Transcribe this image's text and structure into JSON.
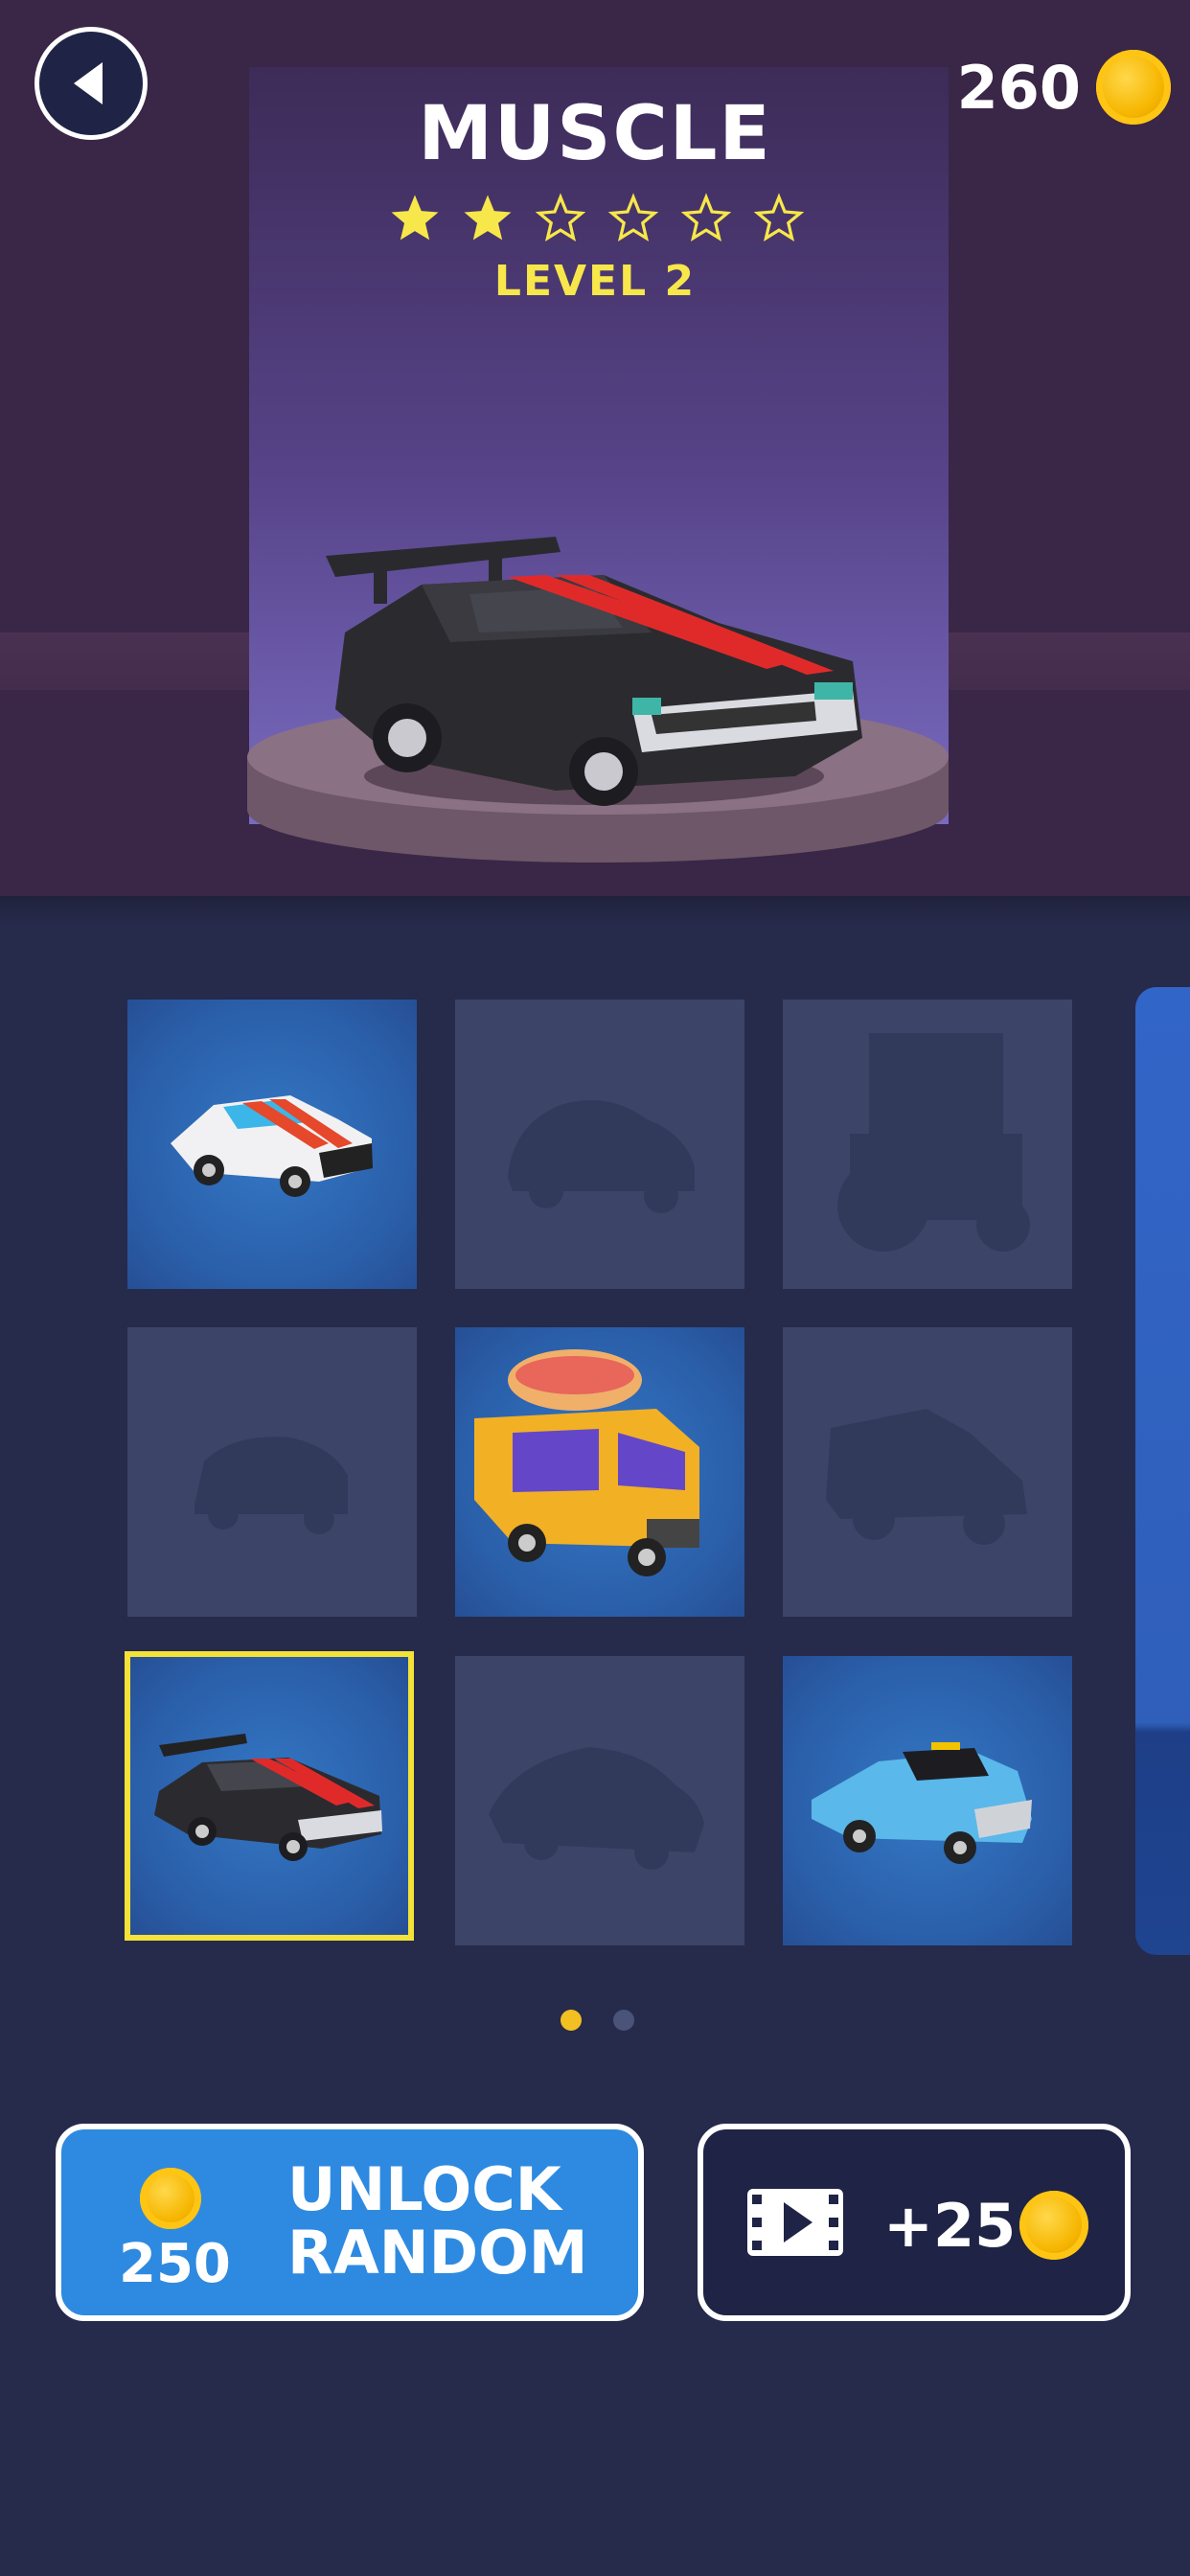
{
  "header": {
    "coin_count": "260",
    "car_name": "MUSCLE",
    "level_label": "LEVEL 2",
    "stars_filled": 2,
    "stars_total": 6
  },
  "grid": {
    "tiles": [
      {
        "state": "owned",
        "vehicle": "white-red-sports-car"
      },
      {
        "state": "locked",
        "vehicle": "beetle-silhouette"
      },
      {
        "state": "locked",
        "vehicle": "tractor-silhouette"
      },
      {
        "state": "locked",
        "vehicle": "small-car-silhouette"
      },
      {
        "state": "owned",
        "vehicle": "hotdog-food-truck"
      },
      {
        "state": "locked",
        "vehicle": "jeep-silhouette"
      },
      {
        "state": "owned",
        "vehicle": "black-muscle-car",
        "selected": true
      },
      {
        "state": "locked",
        "vehicle": "supercar-silhouette"
      },
      {
        "state": "owned",
        "vehicle": "blue-pickup-truck"
      }
    ]
  },
  "pagination": {
    "pages": 2,
    "current": 1
  },
  "buttons": {
    "unlock_price": "250",
    "unlock_label_line1": "UNLOCK",
    "unlock_label_line2": "RANDOM",
    "video_reward": "+25"
  },
  "colors": {
    "accent_yellow": "#f4e238",
    "star_yellow": "#f7e74a",
    "button_blue": "#2e8ae0",
    "coin_gold": "#f6b600",
    "background": "#262a4b"
  }
}
